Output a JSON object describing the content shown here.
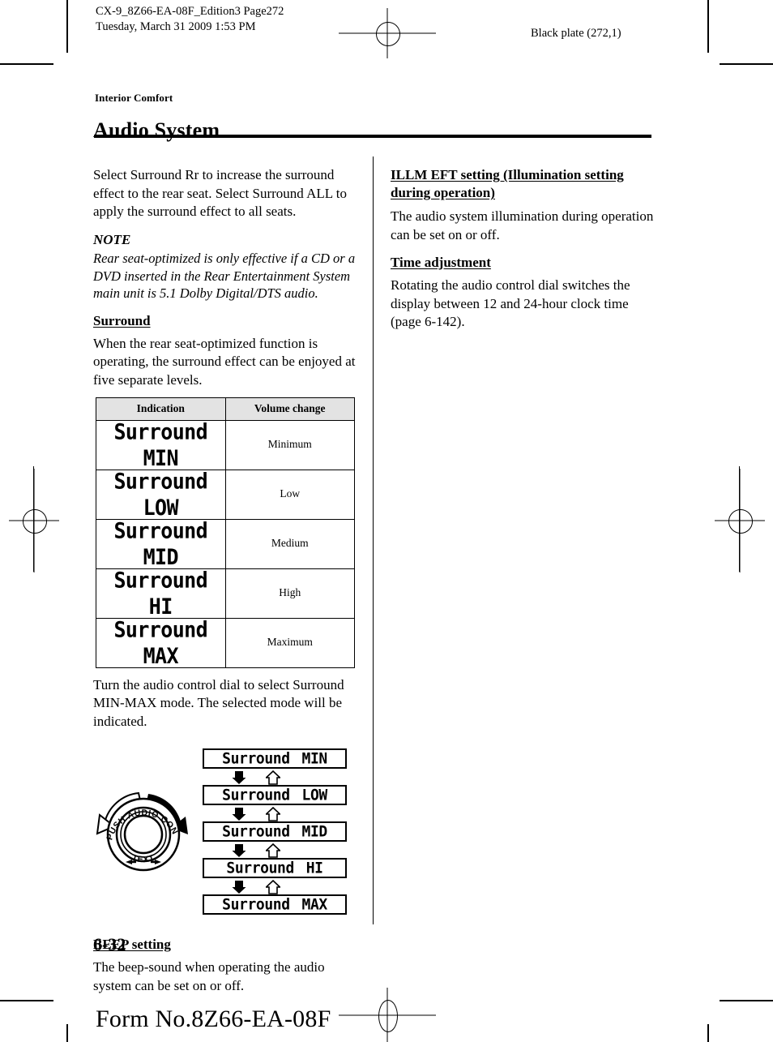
{
  "print_header": {
    "job_info": "CX-9_8Z66-EA-08F_Edition3 Page272\nTuesday, March 31 2009 1:53 PM",
    "plate_label": "Black plate (272,1)"
  },
  "titles": {
    "chapter": "Interior Comfort",
    "page_title": "Audio System"
  },
  "left_column": {
    "intro_paragraph": "Select Surround Rr to increase the surround effect to the rear seat. Select Surround ALL to apply the surround effect to all seats.",
    "note_title": "NOTE",
    "note_body": "Rear seat-optimized is only effective if a CD or a DVD inserted in the Rear Entertainment System main unit is 5.1 Dolby Digital/DTS audio.",
    "surround_heading": "Surround",
    "surround_paragraph": "When the rear seat-optimized function is operating, the surround effect can be enjoyed at five separate levels.",
    "table": {
      "headers": [
        "Indication",
        "Volume change"
      ],
      "rows": [
        {
          "indication_label": "Surround",
          "indication_value": "MIN",
          "volume_change": "Minimum"
        },
        {
          "indication_label": "Surround",
          "indication_value": "LOW",
          "volume_change": "Low"
        },
        {
          "indication_label": "Surround",
          "indication_value": "MID",
          "volume_change": "Medium"
        },
        {
          "indication_label": "Surround",
          "indication_value": "HI",
          "volume_change": "High"
        },
        {
          "indication_label": "Surround",
          "indication_value": "MAX",
          "volume_change": "Maximum"
        }
      ]
    },
    "dial_paragraph": "Turn the audio control dial to select Surround MIN-MAX mode. The selected mode will be indicated.",
    "diagram": {
      "dial_labels": {
        "top": "PUSH AUDIO CONT",
        "bottom": "TEXT"
      },
      "steps": [
        {
          "label": "Surround",
          "value": "MIN"
        },
        {
          "label": "Surround",
          "value": "LOW"
        },
        {
          "label": "Surround",
          "value": "MID"
        },
        {
          "label": "Surround",
          "value": "HI"
        },
        {
          "label": "Surround",
          "value": "MAX"
        }
      ]
    },
    "beep_heading": "BEEP setting",
    "beep_paragraph": "The beep-sound when operating the audio system can be set on or off."
  },
  "right_column": {
    "illm_heading": "ILLM EFT setting (Illumination setting during operation)",
    "illm_paragraph": "The audio system illumination during operation can be set on or off.",
    "time_heading": "Time adjustment",
    "time_paragraph": "Rotating the audio control dial switches the display between 12 and 24-hour clock time (page 6-142)."
  },
  "footer": {
    "page_number": "6-32",
    "form_number": "Form No.8Z66-EA-08F"
  }
}
